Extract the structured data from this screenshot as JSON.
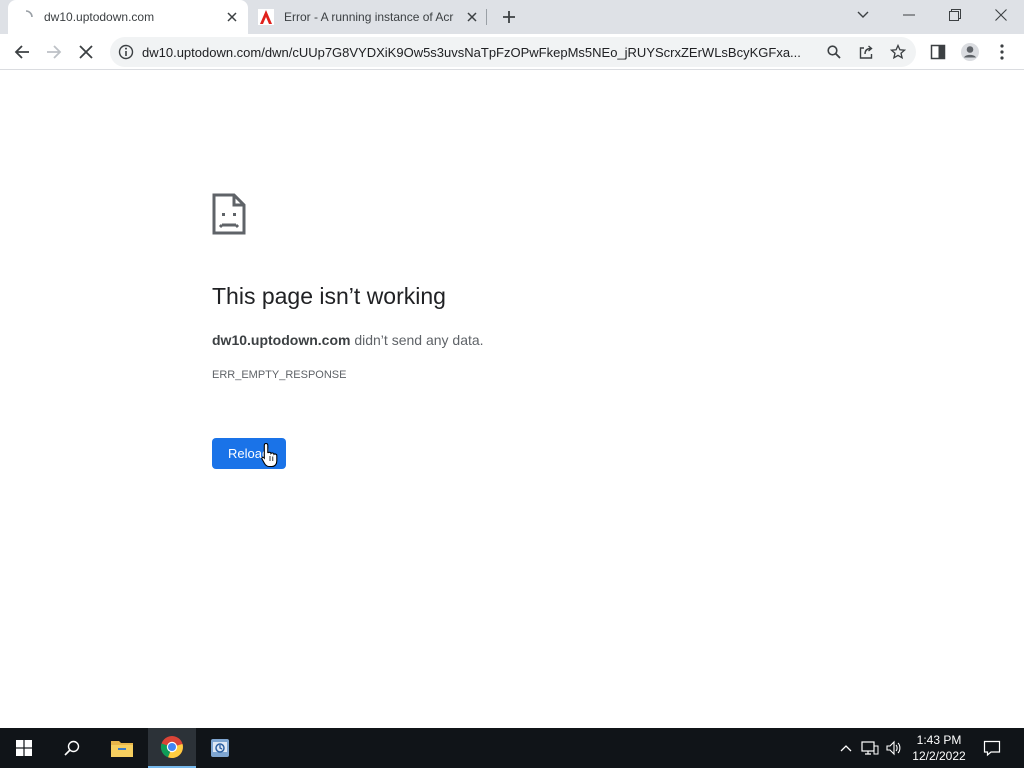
{
  "browser": {
    "tabs": [
      {
        "title": "dw10.uptodown.com",
        "active": true,
        "icon": "loading-favicon-icon"
      },
      {
        "title": "Error - A running instance of Acr",
        "active": false,
        "icon": "adobe-acrobat-icon"
      }
    ],
    "omnibox": {
      "url": "dw10.uptodown.com/dwn/cUUp7G8VYDXiK9Ow5s3uvsNaTpFzOPwFkepMs5NEo_jRUYScrxZErWLsBcyKGFxa..."
    }
  },
  "page": {
    "title": "This page isn’t working",
    "host": "dw10.uptodown.com",
    "message": " didn’t send any data.",
    "error_code": "ERR_EMPTY_RESPONSE",
    "reload_label": "Reload"
  },
  "taskbar": {
    "time": "1:43 PM",
    "date": "12/2/2022"
  },
  "colors": {
    "accent": "#1a73e8",
    "taskbar": "#101418",
    "tabstrip": "#dee1e6"
  }
}
